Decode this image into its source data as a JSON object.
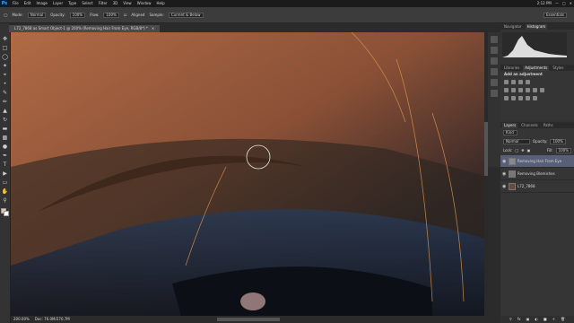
{
  "app": {
    "logo": "Ps"
  },
  "menu": {
    "items": [
      "File",
      "Edit",
      "Image",
      "Layer",
      "Type",
      "Select",
      "Filter",
      "3D",
      "View",
      "Window",
      "Help"
    ]
  },
  "system": {
    "time": "2:12 PM"
  },
  "options": {
    "mode_label": "Mode:",
    "mode_value": "Normal",
    "opacity_label": "Opacity:",
    "opacity_value": "100%",
    "flow_label": "Flow:",
    "flow_value": "100%",
    "aligned_label": "Aligned",
    "sample_label": "Sample:",
    "sample_value": "Current & Below",
    "workspace": "Essentials"
  },
  "document": {
    "tab_title": "L72_7868 as Smart Object-1 @ 200% (Removing Hair From Eye, RGB/8*) *"
  },
  "status": {
    "zoom": "200.00%",
    "doc": "Doc: 76.0M/270.7M"
  },
  "panels": {
    "top_tabs": [
      "Navigator",
      "Histogram"
    ],
    "adjust_tabs": [
      "Libraries",
      "Adjustments",
      "Styles"
    ],
    "adjust_title": "Add an adjustment",
    "layers_tabs": [
      "Layers",
      "Channels",
      "Paths"
    ],
    "kind_label": "Kind",
    "blend_value": "Normal",
    "opacity_label": "Opacity:",
    "opacity_value": "100%",
    "lock_label": "Lock:",
    "fill_label": "Fill:",
    "fill_value": "100%",
    "layers": [
      "Removing Hair From Eye",
      "Removing Blemishes",
      "L72_7868"
    ]
  },
  "colors": {
    "accent": "#31a8ff",
    "selected_layer": "#5a5f78"
  }
}
